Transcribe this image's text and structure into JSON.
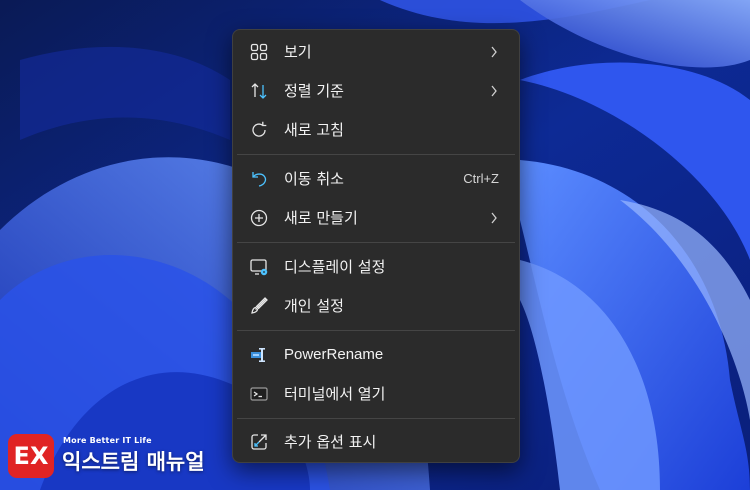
{
  "context_menu": {
    "groups": [
      [
        {
          "label": "보기",
          "icon": "view-grid-icon",
          "submenu": true
        },
        {
          "label": "정렬 기준",
          "icon": "sort-arrows-icon",
          "submenu": true
        },
        {
          "label": "새로 고침",
          "icon": "refresh-icon",
          "submenu": false
        }
      ],
      [
        {
          "label": "이동 취소",
          "icon": "undo-icon",
          "shortcut": "Ctrl+Z"
        },
        {
          "label": "새로 만들기",
          "icon": "new-plus-icon",
          "submenu": true
        }
      ],
      [
        {
          "label": "디스플레이 설정",
          "icon": "display-settings-icon"
        },
        {
          "label": "개인 설정",
          "icon": "personalize-brush-icon"
        }
      ],
      [
        {
          "label": "PowerRename",
          "icon": "powerrename-icon"
        },
        {
          "label": "터미널에서 열기",
          "icon": "terminal-icon"
        }
      ],
      [
        {
          "label": "추가 옵션 표시",
          "icon": "show-more-options-icon"
        }
      ]
    ]
  },
  "watermark": {
    "logo_text": "EX",
    "tagline": "More Better IT Life",
    "name": "익스트림 매뉴얼"
  },
  "colors": {
    "menu_bg": "#2b2b2b",
    "menu_text": "#f2f2f2",
    "accent_icon": "#4cc2ff",
    "watermark_red": "#e02424"
  }
}
